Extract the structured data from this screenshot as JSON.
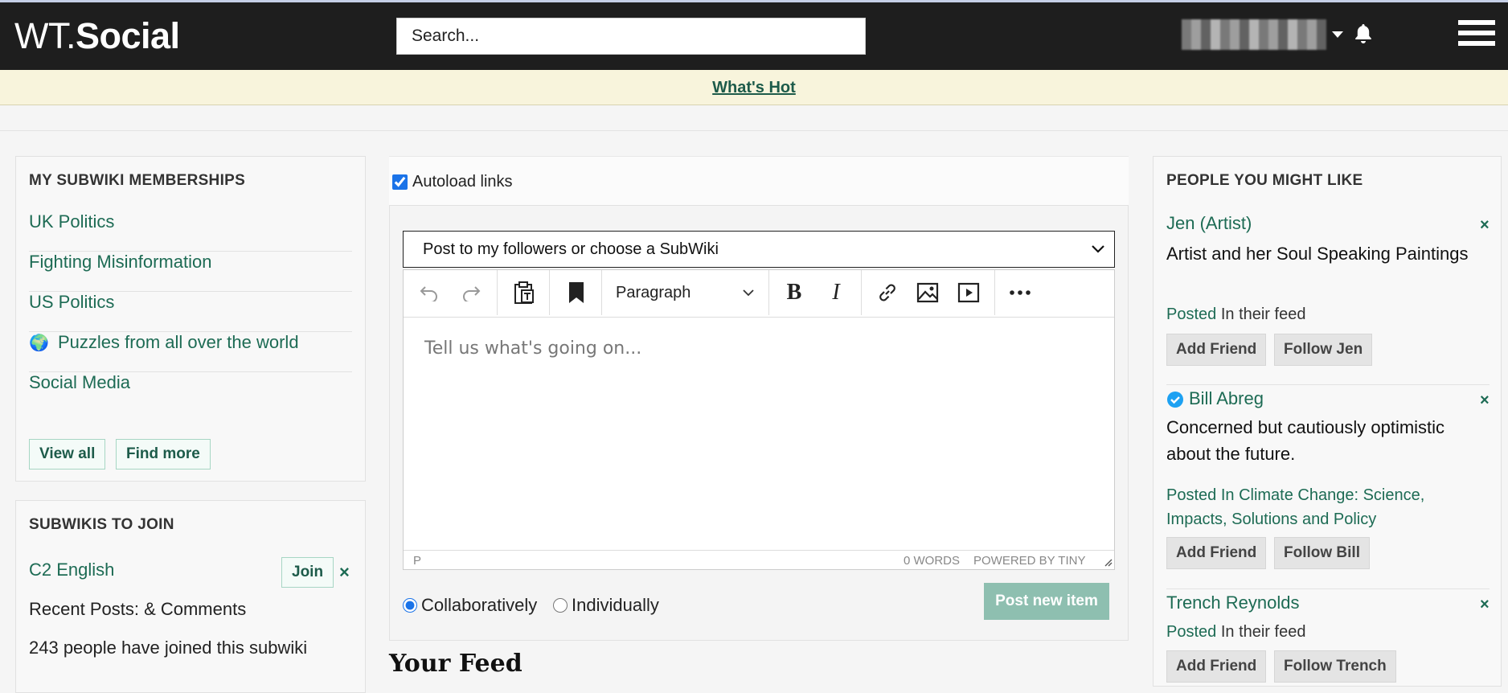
{
  "header": {
    "logo_part1": "WT.",
    "logo_part2": "Social",
    "search_placeholder": "Search..."
  },
  "hotbar": {
    "link": "What's Hot"
  },
  "memberships": {
    "title": "MY SUBWIKI MEMBERSHIPS",
    "items": [
      {
        "label": "UK Politics",
        "emoji": ""
      },
      {
        "label": "Fighting Misinformation",
        "emoji": ""
      },
      {
        "label": "US Politics",
        "emoji": ""
      },
      {
        "label": "Puzzles from all over the world",
        "emoji": "🌍"
      },
      {
        "label": "Social Media",
        "emoji": ""
      }
    ],
    "view_all": "View all",
    "find_more": "Find more"
  },
  "to_join": {
    "title": "SUBWIKIS TO JOIN",
    "name": "C2 English",
    "join": "Join",
    "close": "×",
    "recent": "Recent Posts: & Comments",
    "joined": "243 people have joined this subwiki"
  },
  "composer": {
    "autoload_label": "Autoload links",
    "autoload_checked": true,
    "target_select": "Post to my followers or choose a SubWiki",
    "format_select": "Paragraph",
    "editor_placeholder": "Tell us what's going on...",
    "status_path": "P",
    "word_count": "0 WORDS",
    "powered_by": "POWERED BY TINY",
    "option_collab": "Collaboratively",
    "option_indiv": "Individually",
    "selected_option": "Collaboratively",
    "post_button": "Post new item"
  },
  "feed": {
    "title": "Your Feed"
  },
  "people": {
    "title": "PEOPLE YOU MIGHT LIKE",
    "list": [
      {
        "name": "Jen (Artist)",
        "verified": false,
        "bio": "Artist and her Soul Speaking Paintings",
        "posted": "Posted",
        "in_label": "In their feed",
        "add": "Add Friend",
        "follow": "Follow Jen"
      },
      {
        "name": "Bill Abreg",
        "verified": true,
        "bio": "Concerned but cautiously optimistic about the future.",
        "posted": "Posted",
        "in_label": "In Climate Change: Science, Impacts, Solutions and Policy",
        "add": "Add Friend",
        "follow": "Follow Bill"
      },
      {
        "name": "Trench Reynolds",
        "verified": false,
        "bio": "",
        "posted": "Posted",
        "in_label": "In their feed",
        "add": "Add Friend",
        "follow": "Follow Trench"
      }
    ],
    "close": "×"
  },
  "colors": {
    "navbar": "#1e1e1e",
    "accent_green": "#1d6b54",
    "hotbar_bg": "#f8f4dc",
    "post_button": "#8ebfb0"
  }
}
